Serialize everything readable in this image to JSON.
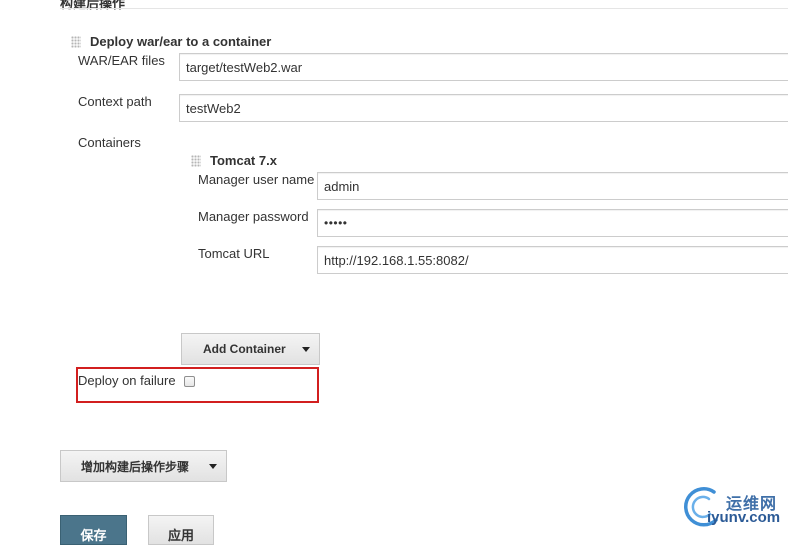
{
  "section": {
    "title": "构建后操作"
  },
  "deploy_block": {
    "title": "Deploy war/ear to a container",
    "war_label": "WAR/EAR files",
    "war_value": "target/testWeb2.war",
    "context_label": "Context path",
    "context_value": "testWeb2",
    "containers_label": "Containers"
  },
  "tomcat_block": {
    "title": "Tomcat 7.x",
    "user_label": "Manager user name",
    "user_value": "admin",
    "password_label": "Manager password",
    "password_value": "•••••",
    "url_label": "Tomcat URL",
    "url_value": "http://192.168.1.55:8082/"
  },
  "add_container": {
    "label": "Add Container"
  },
  "deploy_on_failure": {
    "label": "Deploy on failure",
    "checked": false
  },
  "add_step": {
    "label": "增加构建后操作步骤"
  },
  "footer": {
    "save_label": "保存",
    "apply_label": "应用"
  },
  "watermark": {
    "cn": "运维网",
    "url": "iyunv.com"
  },
  "colors": {
    "highlight": "#d21f1f",
    "save_bg": "#4b758b",
    "watermark": "#3f6fa8"
  }
}
